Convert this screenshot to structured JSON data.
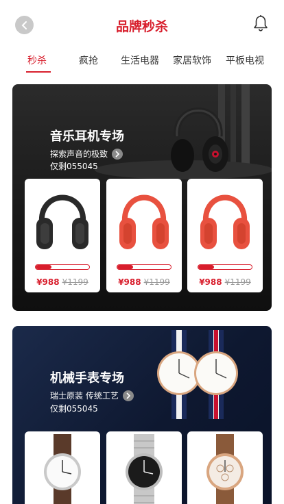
{
  "header": {
    "title": "品牌秒杀",
    "back_icon": "chevron-left-icon",
    "notification_icon": "bell-icon"
  },
  "tabs": [
    {
      "label": "秒杀",
      "active": true
    },
    {
      "label": "疯抢",
      "active": false
    },
    {
      "label": "生活电器",
      "active": false
    },
    {
      "label": "家居软饰",
      "active": false
    },
    {
      "label": "平板电视",
      "active": false
    }
  ],
  "sections": [
    {
      "title": "音乐耳机专场",
      "subtitle": "探索声音的极致",
      "stock": "仅剩055045",
      "products": [
        {
          "price": "¥988",
          "old_price": "¥1199",
          "progress": 0.3,
          "color": "#2a2a2a"
        },
        {
          "price": "¥988",
          "old_price": "¥1199",
          "progress": 0.3,
          "color": "#e8513f"
        },
        {
          "price": "¥988",
          "old_price": "¥1199",
          "progress": 0.3,
          "color": "#e8513f"
        }
      ]
    },
    {
      "title": "机械手表专场",
      "subtitle": "瑞士原装 传统工艺",
      "stock": "仅剩055045",
      "products": [
        {
          "strap_color": "#5a3a2a"
        },
        {
          "strap_color": "#c8c8c8"
        },
        {
          "strap_color": "#8a5a3a"
        }
      ]
    }
  ],
  "colors": {
    "accent": "#d81e2c"
  }
}
